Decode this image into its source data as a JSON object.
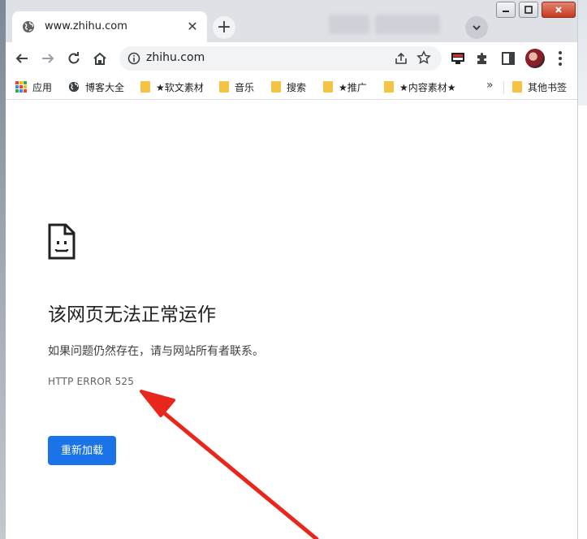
{
  "tab": {
    "title": "www.zhihu.com",
    "close_glyph": "✕",
    "new_tab_glyph": "+",
    "icon": "globe-icon"
  },
  "toolbar": {
    "url": "zhihu.com"
  },
  "bookmarks": [
    {
      "label": "应用",
      "icon": "apps-grid-icon"
    },
    {
      "label": "博客大全",
      "icon": "globe-icon"
    },
    {
      "label": "★软文素材",
      "icon": "folder-icon"
    },
    {
      "label": "音乐",
      "icon": "folder-icon"
    },
    {
      "label": "搜索",
      "icon": "folder-icon"
    },
    {
      "label": "★推广",
      "icon": "folder-icon"
    },
    {
      "label": "★内容素材★",
      "icon": "folder-icon"
    }
  ],
  "bookmarks_more": "»",
  "other_bookmarks": "其他书签",
  "error": {
    "title": "该网页无法正常运作",
    "description": "如果问题仍然存在，请与网站所有者联系。",
    "code": "HTTP ERROR 525",
    "reload_label": "重新加载",
    "icon": "sad-page-icon"
  },
  "colors": {
    "accent": "#1a73e8",
    "annotation_arrow": "#e8261b",
    "tabstrip": "#dee1e6"
  }
}
